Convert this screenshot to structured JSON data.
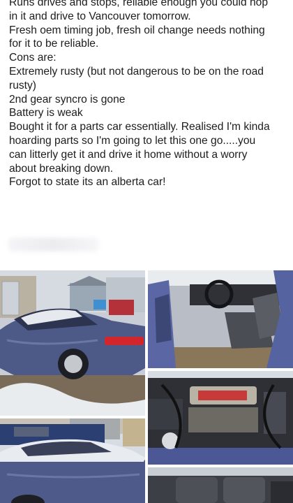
{
  "post": {
    "paragraphs": [
      "Runs drives and stops, reliable enough you could hop\nin it and drive to Vancouver tomorrow.\nFresh oem timing job, fresh oil change needs nothing\nfor it to be reliable.",
      "Cons are:\nExtremely rusty (but not dangerous to be on the road\nrusty)\n2nd gear syncro is gone\nBattery is weak",
      "Bought it for a parts car essentially. Realised I'm kinda\nhoarding parts so I'm going to let this one go.....you\ncan litterly get it and drive it home without a worry\nabout breaking down.",
      "Forgot to state its an alberta car!"
    ]
  },
  "photos": [
    {
      "subject": "car-exterior-rear-quarter"
    },
    {
      "subject": "car-interior"
    },
    {
      "subject": "engine-bay"
    },
    {
      "subject": "car-side-snow"
    },
    {
      "subject": "car-rear-seats"
    }
  ],
  "colors": {
    "car_blue": "#56648f",
    "snow": "#eef1f4",
    "text": "#1c1c1e"
  }
}
